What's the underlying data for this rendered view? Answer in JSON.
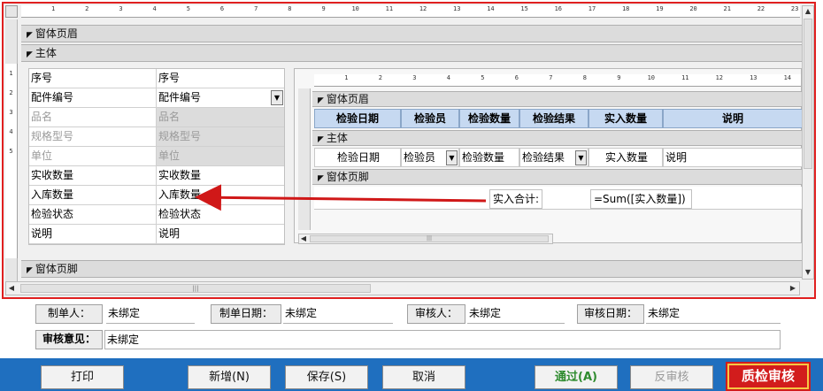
{
  "design": {
    "ruler_marks": [
      "1",
      "2",
      "3",
      "4",
      "5",
      "6",
      "7",
      "8",
      "9",
      "10",
      "11",
      "12",
      "13",
      "14",
      "15",
      "16",
      "17",
      "18",
      "19",
      "20",
      "21",
      "22",
      "23"
    ],
    "vruler_marks": [
      "1",
      "2",
      "3",
      "4",
      "5"
    ],
    "header_section": "窗体页眉",
    "detail_section": "主体",
    "footer_section": "窗体页脚",
    "fields": [
      {
        "label": "序号",
        "value": "序号",
        "dim": false,
        "combo": false
      },
      {
        "label": "配件编号",
        "value": "配件编号",
        "dim": false,
        "combo": true
      },
      {
        "label": "品名",
        "value": "品名",
        "dim": true,
        "combo": false
      },
      {
        "label": "规格型号",
        "value": "规格型号",
        "dim": true,
        "combo": false
      },
      {
        "label": "单位",
        "value": "单位",
        "dim": true,
        "combo": false
      },
      {
        "label": "实收数量",
        "value": "实收数量",
        "dim": false,
        "combo": false
      },
      {
        "label": "入库数量",
        "value": "入库数量",
        "dim": false,
        "combo": false
      },
      {
        "label": "检验状态",
        "value": "检验状态",
        "dim": false,
        "combo": false
      },
      {
        "label": "说明",
        "value": "说明",
        "dim": false,
        "combo": false
      }
    ]
  },
  "subform": {
    "ruler_marks": [
      "1",
      "2",
      "3",
      "4",
      "5",
      "6",
      "7",
      "8",
      "9",
      "10",
      "11",
      "12",
      "13",
      "14"
    ],
    "header_section": "窗体页眉",
    "detail_section": "主体",
    "footer_section": "窗体页脚",
    "headers": [
      "检验日期",
      "检验员",
      "检验数量",
      "检验结果",
      "实入数量",
      "说明"
    ],
    "details": [
      "检验日期",
      "检验员",
      "检验数量",
      "检验结果",
      "实入数量",
      "说明"
    ],
    "total_label": "实入合计:",
    "total_expr": "=Sum([实入数量])"
  },
  "info": {
    "creator_label": "制单人：",
    "creator_value": "未绑定",
    "create_date_label": "制单日期：",
    "create_date_value": "未绑定",
    "reviewer_label": "审核人：",
    "reviewer_value": "未绑定",
    "review_date_label": "审核日期：",
    "review_date_value": "未绑定",
    "opinion_label": "审核意见：",
    "opinion_value": "未绑定"
  },
  "toolbar": {
    "print": "打印",
    "add": "新增(N)",
    "save": "保存(S)",
    "cancel": "取消",
    "pass": "通过(A)",
    "unreview": "反审核",
    "qc_review": "质检审核"
  },
  "colors": {
    "highlight_border": "#e02020",
    "toolbar_bg": "#1f6fbf",
    "subform_header_bg": "#c6d9f1",
    "qc_button_bg": "#d21c1c",
    "pass_text": "#2e8b2e"
  }
}
